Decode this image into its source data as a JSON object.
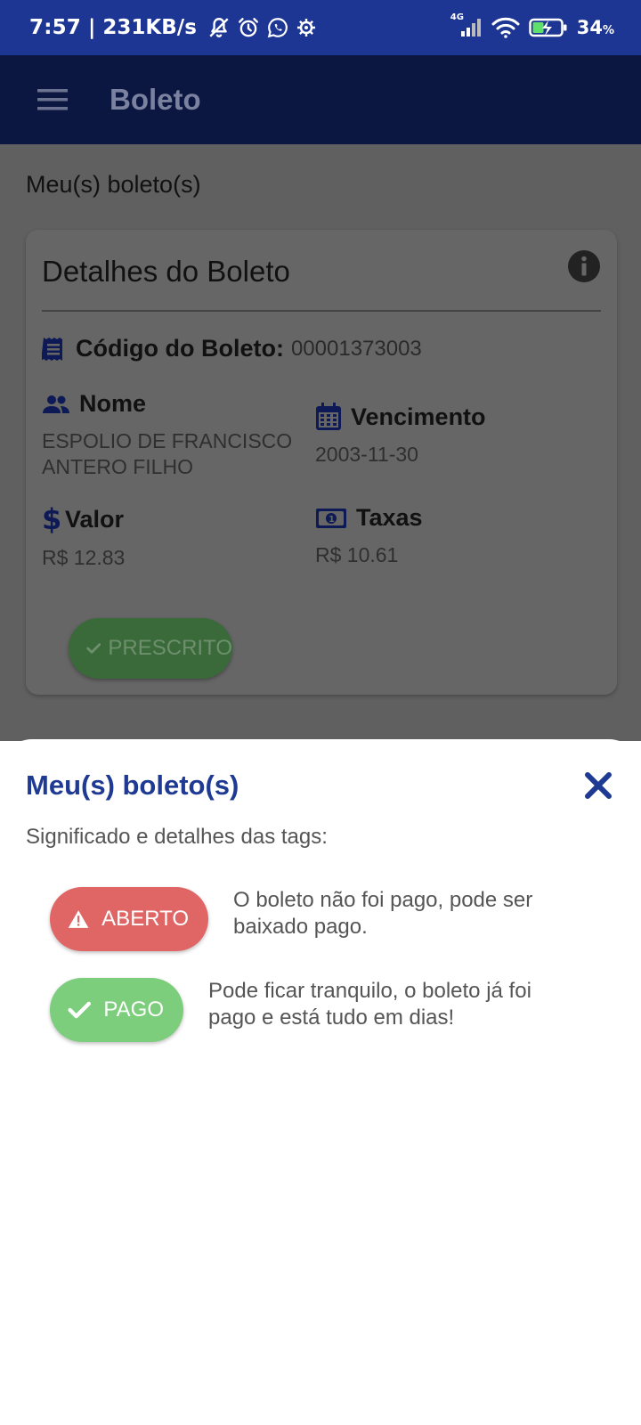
{
  "status_bar": {
    "time": "7:57",
    "speed": "| 231KB/s",
    "network": "4G",
    "battery": "34",
    "battery_unit": "%"
  },
  "app_bar": {
    "title": "Boleto"
  },
  "page": {
    "section_title": "Meu(s) boleto(s)",
    "card": {
      "title": "Detalhes do Boleto",
      "code_label": "Código do Boleto:",
      "code_value": "00001373003",
      "nome_label": "Nome",
      "nome_value": "ESPOLIO DE FRANCISCO ANTERO FILHO",
      "vencimento_label": "Vencimento",
      "vencimento_value": "2003-11-30",
      "valor_label": "Valor",
      "valor_value": "R$ 12.83",
      "taxas_label": "Taxas",
      "taxas_value": "R$ 10.61",
      "status_label": "PRESCRITO"
    }
  },
  "sheet": {
    "title": "Meu(s) boleto(s)",
    "subtitle": "Significado e detalhes das tags:",
    "tags": [
      {
        "label": "ABERTO",
        "description": "O boleto não foi pago, pode ser baixado pago.",
        "color": "#e06666",
        "icon": "warning-icon"
      },
      {
        "label": "PAGO",
        "description": "Pode ficar tranquilo, o boleto já foi pago e está tudo em dias!",
        "color": "#7ccd7c",
        "icon": "check-icon"
      }
    ]
  },
  "colors": {
    "primary": "#1d3593",
    "sheet_title": "#1f3a93",
    "aberto": "#e06666",
    "pago": "#7ccd7c"
  }
}
